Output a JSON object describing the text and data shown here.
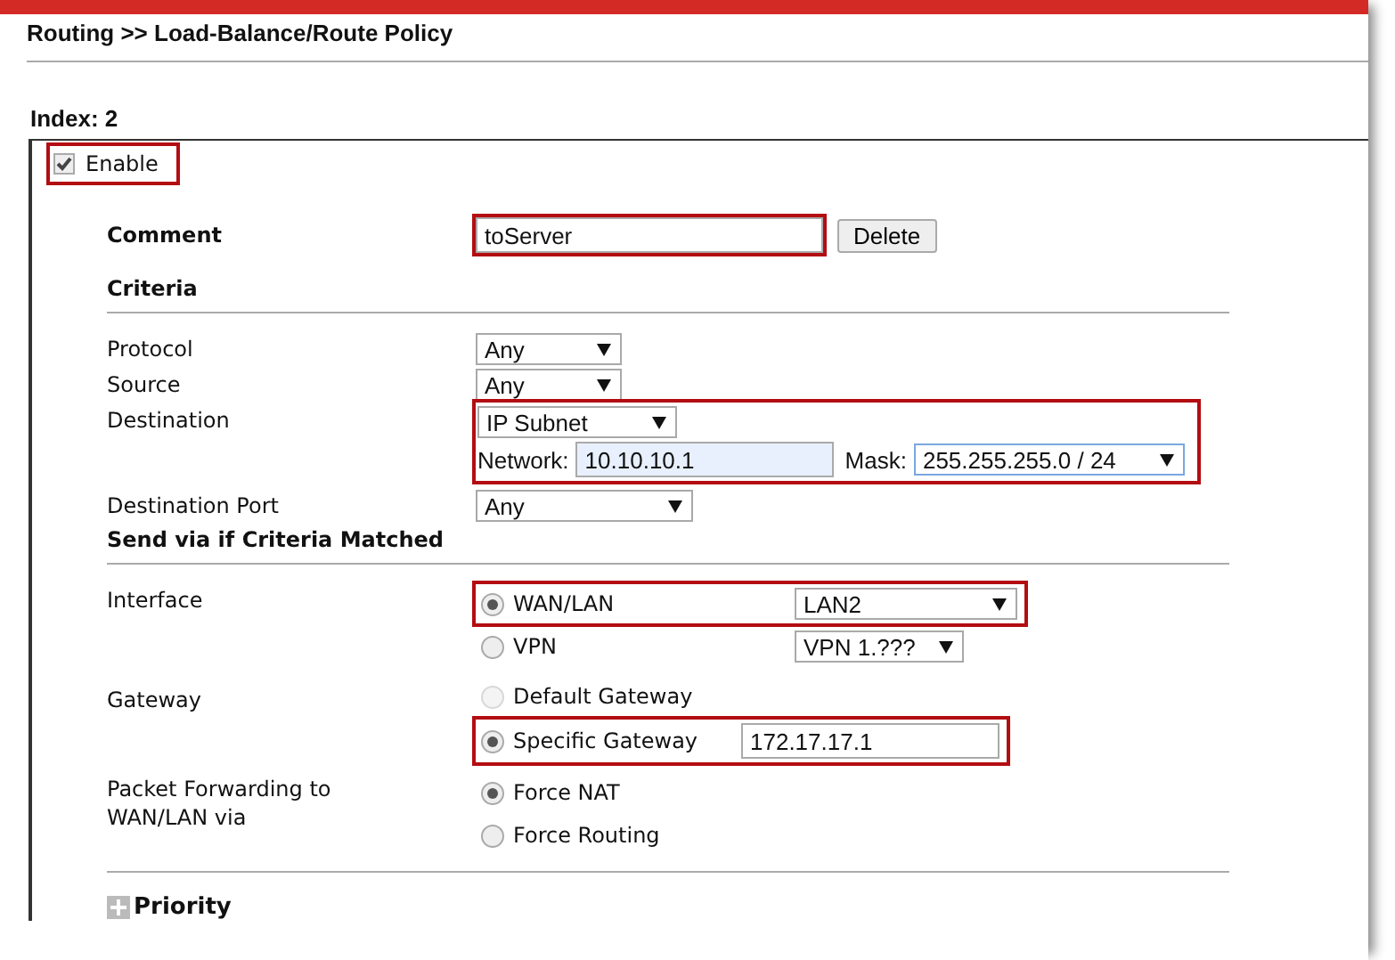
{
  "breadcrumb": "Routing >> Load-Balance/Route Policy",
  "index": "Index: 2",
  "enable": {
    "label": "Enable",
    "checked": true,
    "highlighted": true
  },
  "comment": {
    "label": "Comment",
    "value": "toServer",
    "highlighted": true,
    "button": "Delete"
  },
  "criteria": {
    "heading": "Criteria",
    "rows": [
      {
        "kind": "select",
        "label": "Protocol",
        "value": "Any"
      },
      {
        "kind": "select",
        "label": "Source",
        "value": "Any"
      },
      {
        "kind": "subnet",
        "label": "Destination",
        "value": "IP Subnet",
        "network_label": "Network:",
        "network": "10.10.10.1",
        "mask_label": "Mask:",
        "mask": "255.255.255.0 / 24",
        "highlighted": true
      },
      {
        "kind": "select",
        "label": "Destination Port",
        "value": "Any"
      }
    ]
  },
  "send_via": {
    "heading": "Send via if Criteria Matched",
    "groups": [
      {
        "label": "Interface",
        "options": [
          {
            "label": "WAN/LAN",
            "selected": true,
            "select": "LAN2",
            "highlighted": true
          },
          {
            "label": "VPN",
            "selected": false,
            "select": "VPN 1.???",
            "highlighted": false
          }
        ]
      },
      {
        "label": "Gateway",
        "options": [
          {
            "label": "Default Gateway",
            "selected": false,
            "disabled": true,
            "highlighted": false
          },
          {
            "label": "Specific Gateway",
            "selected": true,
            "disabled": false,
            "input": "172.17.17.1",
            "highlighted": true
          }
        ]
      },
      {
        "label": "Packet Forwarding to WAN/LAN via",
        "options": [
          {
            "label": "Force NAT",
            "selected": true
          },
          {
            "label": "Force Routing",
            "selected": false
          }
        ]
      }
    ]
  },
  "priority": {
    "label": "Priority",
    "expanded": false
  }
}
